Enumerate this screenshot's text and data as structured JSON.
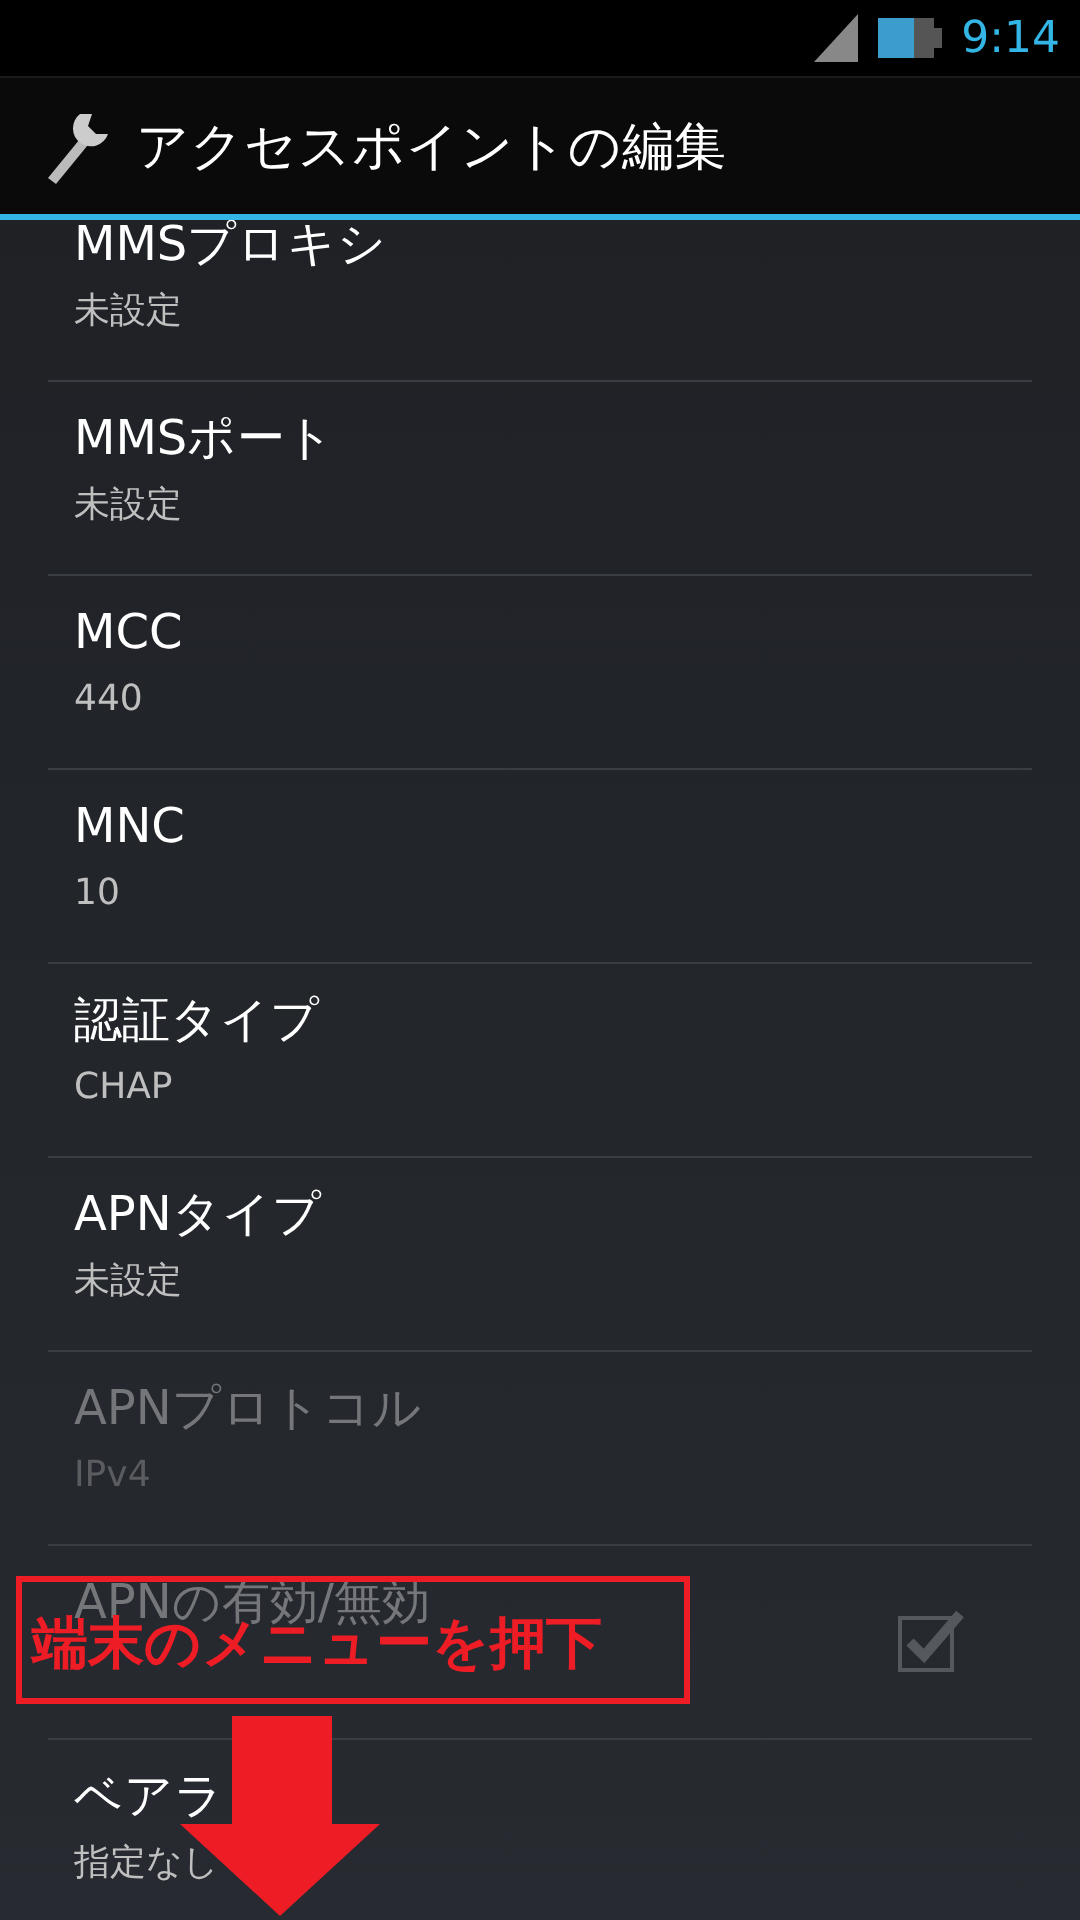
{
  "status_bar": {
    "time": "9:14"
  },
  "action_bar": {
    "title": "アクセスポイントの編集"
  },
  "settings": [
    {
      "kind": "text",
      "title": "MMSプロキシ",
      "summary": "未設定",
      "disabled": false
    },
    {
      "kind": "text",
      "title": "MMSポート",
      "summary": "未設定",
      "disabled": false
    },
    {
      "kind": "text",
      "title": "MCC",
      "summary": "440",
      "disabled": false
    },
    {
      "kind": "text",
      "title": "MNC",
      "summary": "10",
      "disabled": false
    },
    {
      "kind": "text",
      "title": "認証タイプ",
      "summary": "CHAP",
      "disabled": false
    },
    {
      "kind": "text",
      "title": "APNタイプ",
      "summary": "未設定",
      "disabled": false
    },
    {
      "kind": "text",
      "title": "APNプロトコル",
      "summary": "IPv4",
      "disabled": true
    },
    {
      "kind": "checkbox",
      "title": "APNの有効/無効",
      "disabled": true,
      "checked": true
    },
    {
      "kind": "text",
      "title": "ベアラ",
      "summary": "指定なし",
      "disabled": false
    }
  ],
  "annotation": {
    "label": "端末のメニューを押下"
  }
}
